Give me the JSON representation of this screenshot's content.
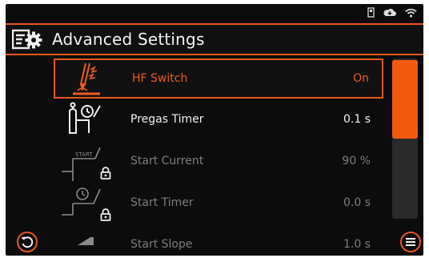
{
  "header": {
    "title": "Advanced Settings",
    "icon": "settings-gear-icon"
  },
  "status": {
    "icons": [
      "usb-stick-icon",
      "cloud-icon",
      "wifi-icon"
    ]
  },
  "items": [
    {
      "label": "HF Switch",
      "value": "On",
      "icon": "hf-torch-icon",
      "state": "selected",
      "locked": false
    },
    {
      "label": "Pregas Timer",
      "value": "0.1 s",
      "icon": "gas-cylinder-timer-icon",
      "state": "normal",
      "locked": false
    },
    {
      "label": "Start Current",
      "value": "90 %",
      "icon": "start-current-icon",
      "state": "locked",
      "locked": true
    },
    {
      "label": "Start Timer",
      "value": "0.0 s",
      "icon": "start-timer-icon",
      "state": "locked",
      "locked": true
    },
    {
      "label": "Start Slope",
      "value": "1.0 s",
      "icon": "start-slope-icon",
      "state": "locked",
      "locked": false
    }
  ],
  "scroll": {
    "position_fraction": 0.0,
    "visible_fraction": 0.5
  },
  "footer": {
    "back_icon": "back-undo-icon",
    "menu_icon": "menu-icon"
  },
  "colors": {
    "accent": "#e8561d",
    "background": "#0c0c0c",
    "text": "#f0f0f0",
    "disabled_text": "#7d7d7d"
  }
}
